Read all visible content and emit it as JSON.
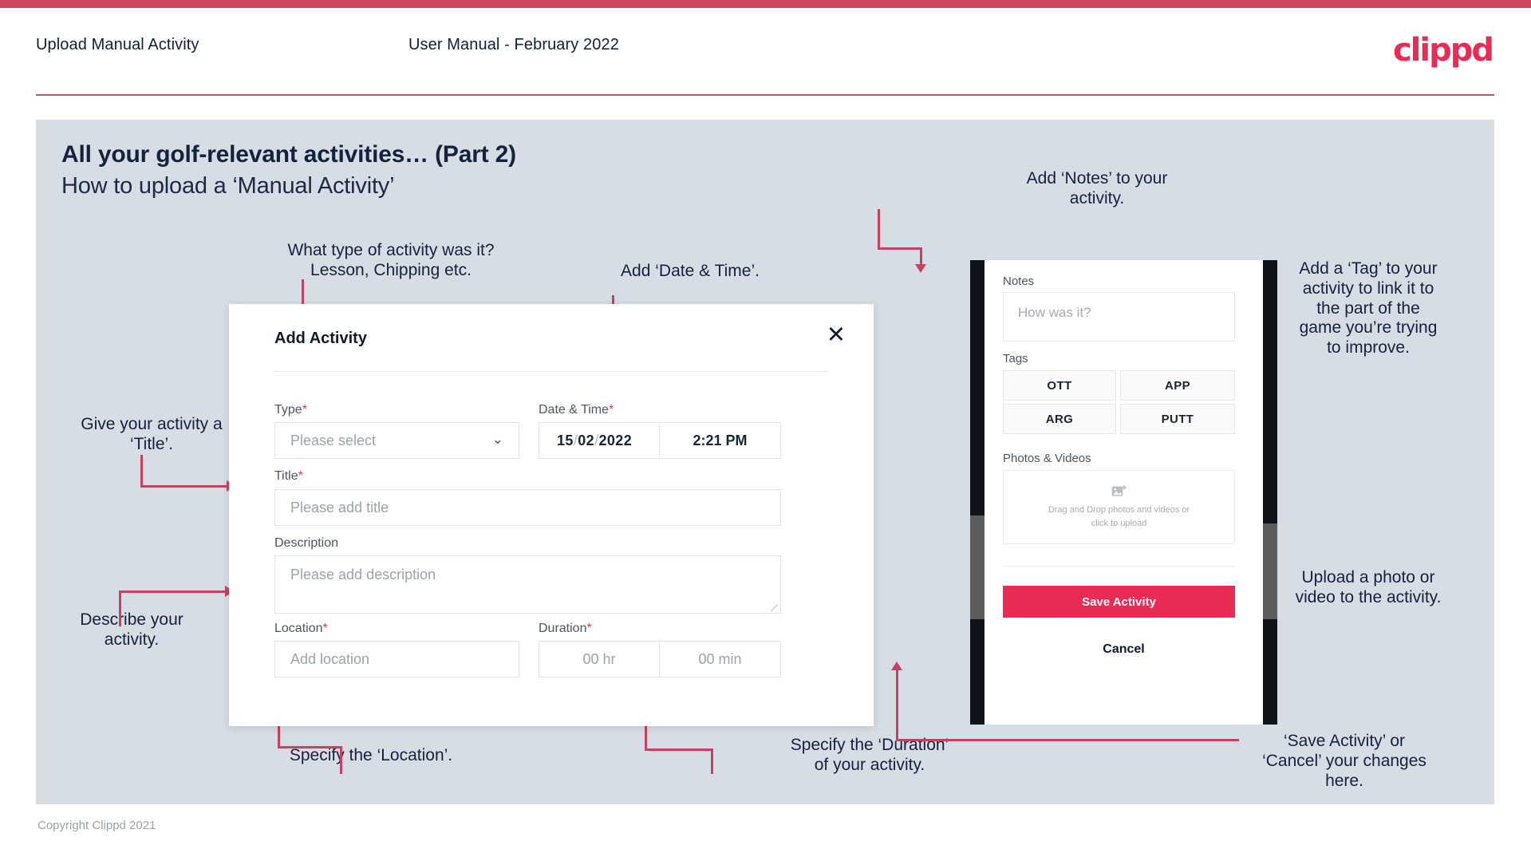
{
  "header": {
    "title": "Upload Manual Activity",
    "subtitle": "User Manual - February 2022",
    "logo": "clippd"
  },
  "slide": {
    "title": "All your golf-relevant activities… (Part 2)",
    "subtitle": "How to upload a ‘Manual Activity’",
    "copyright": "Copyright Clippd 2021"
  },
  "dialog": {
    "title": "Add Activity",
    "close_icon": "✕",
    "fields": {
      "type": {
        "label": "Type",
        "required": "*",
        "placeholder": "Please select",
        "chevron": "⌄"
      },
      "datetime": {
        "label": "Date & Time",
        "required": "*",
        "day": "15",
        "month": "02",
        "year": "2022",
        "sep": "/",
        "time": "2:21 PM"
      },
      "title": {
        "label": "Title",
        "required": "*",
        "placeholder": "Please add title"
      },
      "description": {
        "label": "Description",
        "required": "",
        "placeholder": "Please add description"
      },
      "location": {
        "label": "Location",
        "required": "*",
        "placeholder": "Add location"
      },
      "duration": {
        "label": "Duration",
        "required": "*",
        "hours": "00 hr",
        "minutes": "00 min"
      }
    }
  },
  "phone": {
    "notes": {
      "label": "Notes",
      "placeholder": "How was it?"
    },
    "tags": {
      "label": "Tags",
      "items": [
        "OTT",
        "APP",
        "ARG",
        "PUTT"
      ]
    },
    "photos": {
      "label": "Photos & Videos",
      "drop_line1": "Drag and Drop photos and videos or",
      "drop_line2": "click to upload"
    },
    "save_label": "Save Activity",
    "cancel_label": "Cancel"
  },
  "annotations": {
    "type": "What type of activity was it?\nLesson, Chipping etc.",
    "datetime": "Add ‘Date & Time’.",
    "title": "Give your activity a\n‘Title’.",
    "description": "Describe your\nactivity.",
    "location": "Specify the ‘Location’.",
    "duration": "Specify the ‘Duration’\nof your activity.",
    "notes": "Add ‘Notes’ to your\nactivity.",
    "tags": "Add a ‘Tag’ to your\nactivity to link it to\nthe part of the\ngame you’re trying\nto improve.",
    "photos": "Upload a photo or\nvideo to the activity.",
    "save": "‘Save Activity’ or\n‘Cancel’ your changes\nhere."
  },
  "colors": {
    "brand": "#eb2a56",
    "accent_arrow": "#c94060",
    "slide_bg": "#d7dde5",
    "text_dark": "#15223c"
  }
}
